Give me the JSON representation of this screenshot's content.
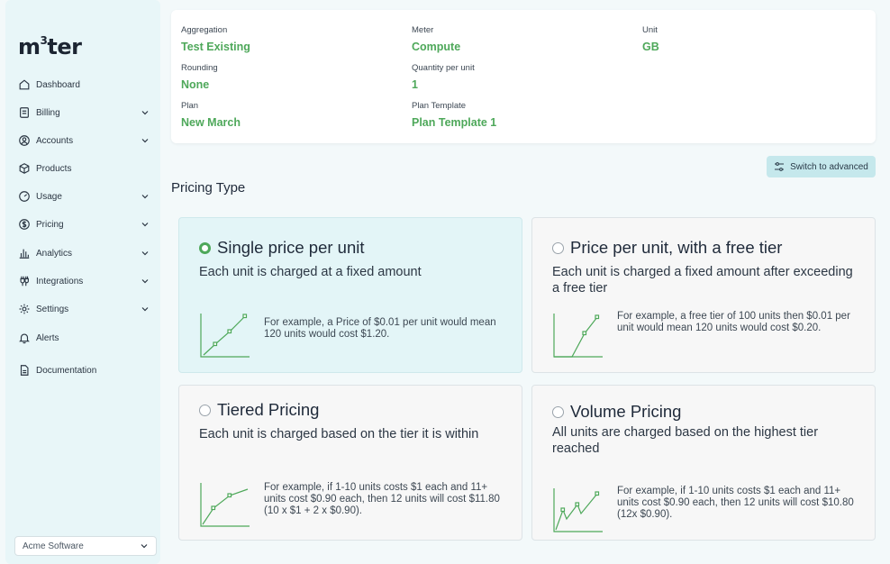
{
  "brand": {
    "logo_main": "m",
    "logo_sup": "3",
    "logo_rest": "ter"
  },
  "sidebar": {
    "items": [
      {
        "label": "Dashboard",
        "icon": "home-icon",
        "has_chevron": false
      },
      {
        "label": "Billing",
        "icon": "invoice-icon",
        "has_chevron": true
      },
      {
        "label": "Accounts",
        "icon": "user-circle-icon",
        "has_chevron": true
      },
      {
        "label": "Products",
        "icon": "box-icon",
        "has_chevron": false
      },
      {
        "label": "Usage",
        "icon": "gauge-icon",
        "has_chevron": true
      },
      {
        "label": "Pricing",
        "icon": "dollar-icon",
        "has_chevron": true
      },
      {
        "label": "Analytics",
        "icon": "bar-chart-icon",
        "has_chevron": true
      },
      {
        "label": "Integrations",
        "icon": "plug-icon",
        "has_chevron": true
      },
      {
        "label": "Settings",
        "icon": "gear-icon",
        "has_chevron": true
      },
      {
        "label": "Alerts",
        "icon": "bell-icon",
        "has_chevron": false
      },
      {
        "label": "Documentation",
        "icon": "document-icon",
        "has_chevron": false
      }
    ],
    "org_select": {
      "value": "Acme Software"
    }
  },
  "summary": {
    "aggregation": {
      "label": "Aggregation",
      "value": "Test Existing"
    },
    "meter": {
      "label": "Meter",
      "value": "Compute"
    },
    "unit": {
      "label": "Unit",
      "value": "GB"
    },
    "rounding": {
      "label": "Rounding",
      "value": "None"
    },
    "quantity": {
      "label": "Quantity per unit",
      "value": "1"
    },
    "plan": {
      "label": "Plan",
      "value": "New March"
    },
    "plan_template": {
      "label": "Plan Template",
      "value": "Plan Template 1"
    }
  },
  "toolbar": {
    "advanced_label": "Switch to advanced"
  },
  "pricing": {
    "title": "Pricing Type",
    "options": [
      {
        "title": "Single price per unit",
        "description": "Each unit is charged at a fixed amount",
        "example": "For example, a Price of $0.01 per unit would mean 120 units would cost $1.20.",
        "selected": true
      },
      {
        "title": "Price per unit, with a free tier",
        "description": "Each unit is charged a fixed amount after exceeding a free tier",
        "example": "For example, a free tier of 100 units then $0.01 per unit would mean 120 units would cost $0.20.",
        "selected": false
      },
      {
        "title": "Tiered Pricing",
        "description": "Each unit is charged based on the tier it is within",
        "example": "For example, if 1-10 units costs $1 each and 11+ units cost $0.90 each, then 12 units will cost $11.80 (10 x $1 + 2 x $0.90).",
        "selected": false
      },
      {
        "title": "Volume Pricing",
        "description": "All units are charged based on the highest tier reached",
        "example": "For example, if 1-10 units costs $1 each and 11+ units cost $0.90 each, then 12 units will cost $10.80 (12x $0.90).",
        "selected": false
      }
    ]
  },
  "colors": {
    "accent": "#4ea85a",
    "sidebar_bg": "#e8f6f8",
    "selected_card": "#e3f5f7",
    "button_bg": "#c5e8ec"
  }
}
